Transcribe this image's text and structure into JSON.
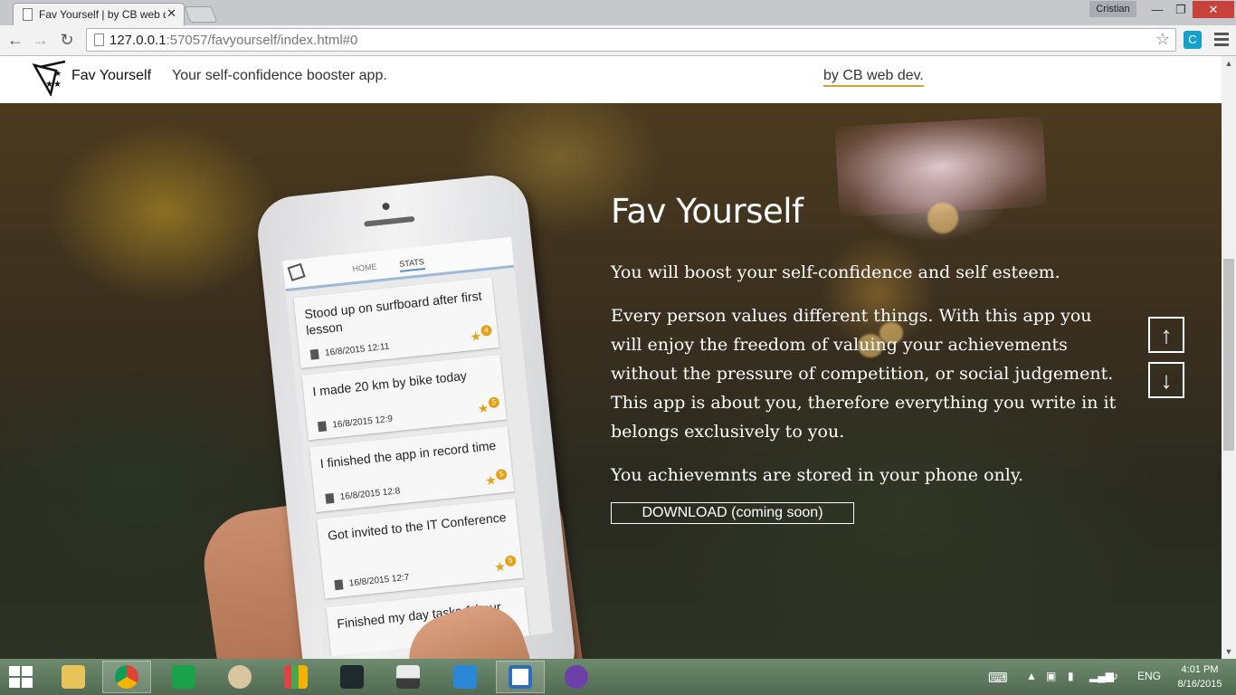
{
  "browser": {
    "tab_title": "Fav Yourself | by CB web dev.",
    "tab_close": "✕",
    "user": "Cristian",
    "minimize": "—",
    "maximize": "❐",
    "close": "✕",
    "back": "←",
    "forward": "→",
    "reload": "↻",
    "url_host": "127.0.0.1",
    "url_rest": ":57057/favyourself/index.html#0",
    "bookmark": "☆",
    "extension": "C"
  },
  "header": {
    "brand": "Fav Yourself",
    "tagline": "Your self-confidence booster app.",
    "byline": "by CB web dev."
  },
  "phone": {
    "tabs": [
      "HOME",
      "STATS"
    ],
    "cards": [
      {
        "text": "Stood up on surfboard after first lesson",
        "date": "16/8/2015 12:11",
        "badge": "4"
      },
      {
        "text": "I made 20 km by bike today",
        "date": "16/8/2015 12:9",
        "badge": "5"
      },
      {
        "text": "I finished the app in record time",
        "date": "16/8/2015 12:8",
        "badge": "5"
      },
      {
        "text": "Got invited to the IT Conference",
        "date": "16/8/2015 12:7",
        "badge": "5"
      },
      {
        "text": "Finished my day tasks 1 hour",
        "date": "",
        "badge": ""
      }
    ]
  },
  "hero": {
    "title": "Fav Yourself",
    "p1": "You will boost your self-confidence and self esteem.",
    "p2": "Every person values different things. With this app you will enjoy the freedom of valuing your achievements without the pressure of competition, or social judgement. This app is about you, therefore everything you write in it belongs exclusively to you.",
    "p3": "You achievemnts are stored in your phone only.",
    "download": "DOWNLOAD (coming soon)",
    "up": "↑",
    "down": "↓"
  },
  "taskbar": {
    "apps": [
      "file-explorer-icon",
      "chrome-icon",
      "store-icon",
      "paint-icon",
      "grid-app-icon",
      "fitbit-icon",
      "scanner-icon",
      "calculator-icon",
      "brackets-icon",
      "github-icon"
    ],
    "lang": "ENG",
    "time": "4:01 PM",
    "date": "8/16/2015"
  }
}
